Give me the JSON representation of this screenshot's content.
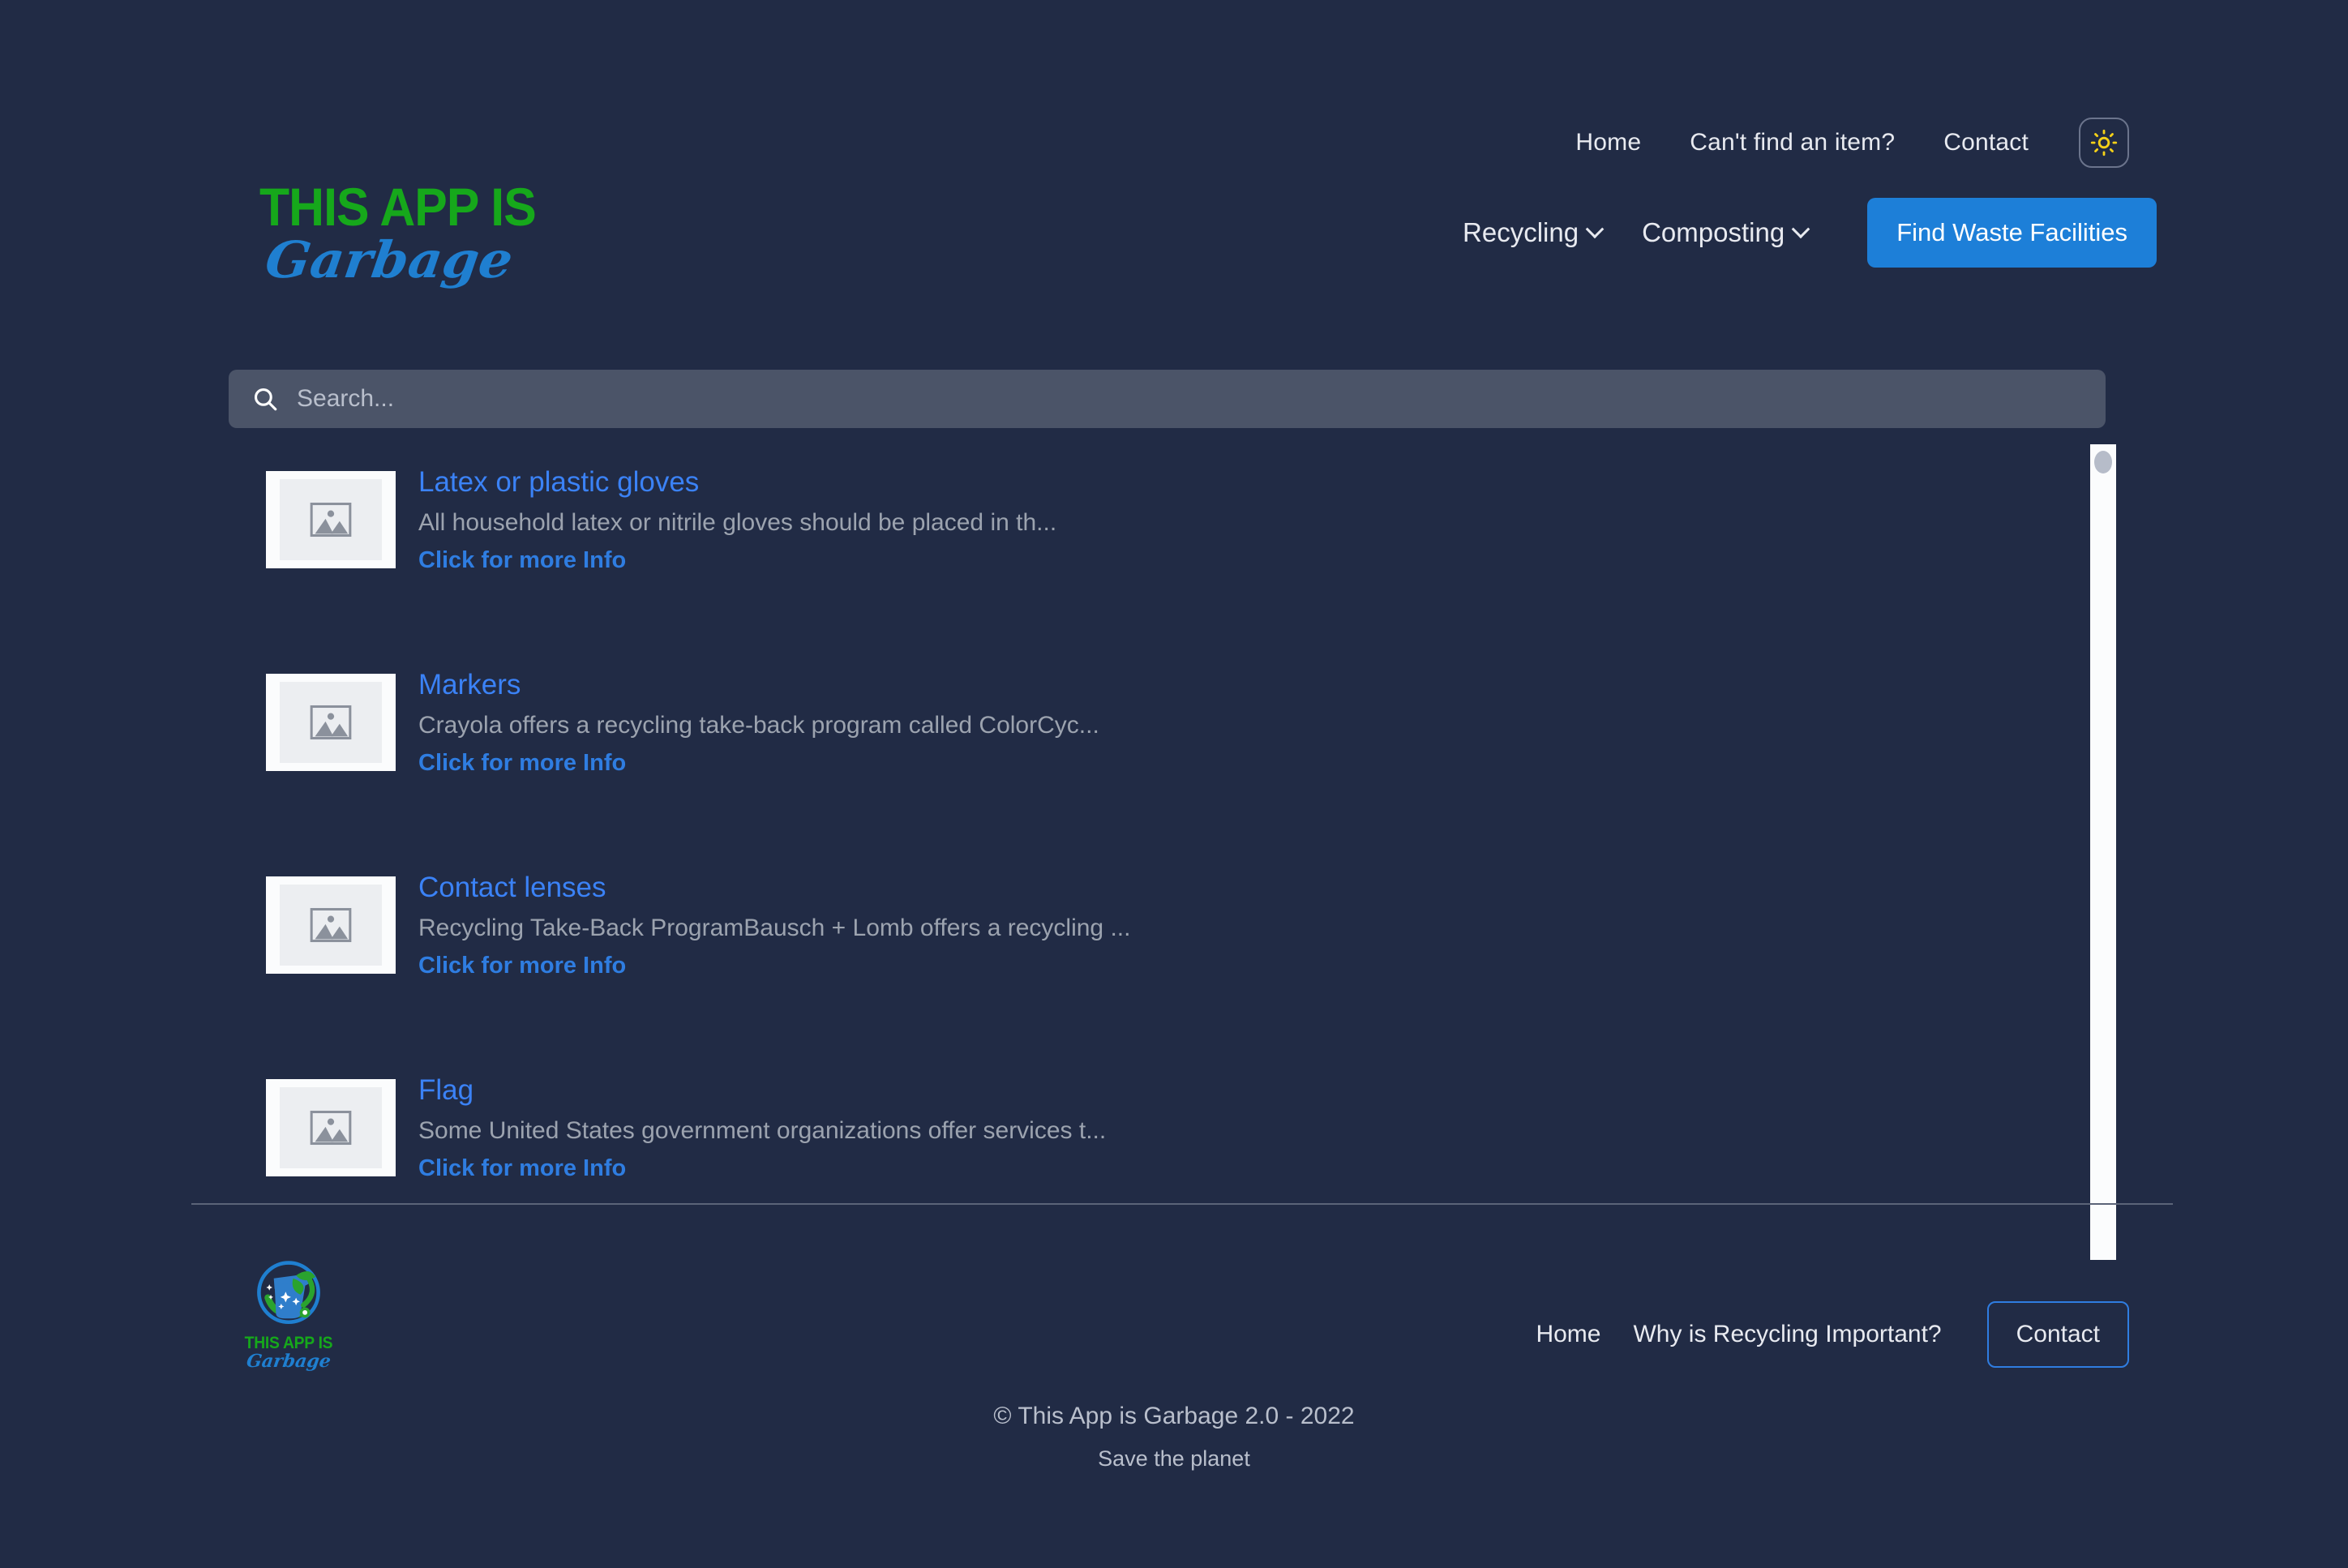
{
  "brand": {
    "logo_line1": "THIS APP IS",
    "logo_line2": "Garbage",
    "logo_icon": "recycling-bin-emblem-icon"
  },
  "topbar": {
    "links": [
      {
        "label": "Home"
      },
      {
        "label": "Can't find an item?"
      },
      {
        "label": "Contact"
      }
    ],
    "theme_toggle_icon": "sun-icon",
    "theme_toggle_color": "#f5d118"
  },
  "mainnav": {
    "items": [
      {
        "label": "Recycling",
        "icon": "chevron-down-icon"
      },
      {
        "label": "Composting",
        "icon": "chevron-down-icon"
      }
    ],
    "cta_label": "Find Waste Facilities",
    "cta_color": "#1d7fd8"
  },
  "search": {
    "placeholder": "Search...",
    "value": "",
    "icon": "search-icon"
  },
  "results": [
    {
      "title": "Latex or plastic gloves",
      "description": "All household latex or nitrile gloves should be placed in th...",
      "link_label": "Click for more Info",
      "thumb_icon": "broken-image-icon"
    },
    {
      "title": "Markers",
      "description": "Crayola offers a recycling take-back program called ColorCyc...",
      "link_label": "Click for more Info",
      "thumb_icon": "broken-image-icon"
    },
    {
      "title": "Contact lenses",
      "description": "Recycling Take-Back ProgramBausch + Lomb offers a recycling ...",
      "link_label": "Click for more Info",
      "thumb_icon": "broken-image-icon"
    },
    {
      "title": "Flag",
      "description": "Some United States government organizations offer services t...",
      "link_label": "Click for more Info",
      "thumb_icon": "broken-image-icon"
    }
  ],
  "footer": {
    "links": [
      {
        "label": "Home"
      },
      {
        "label": "Why is Recycling Important?"
      }
    ],
    "contact_label": "Contact",
    "copyright": "© This App is Garbage 2.0 - 2022",
    "tagline": "Save the planet"
  },
  "colors": {
    "background": "#212b45",
    "accent_blue": "#2f7de1",
    "accent_green": "#16a81b",
    "search_field": "#4b5468",
    "muted_text": "#9ca3af"
  }
}
